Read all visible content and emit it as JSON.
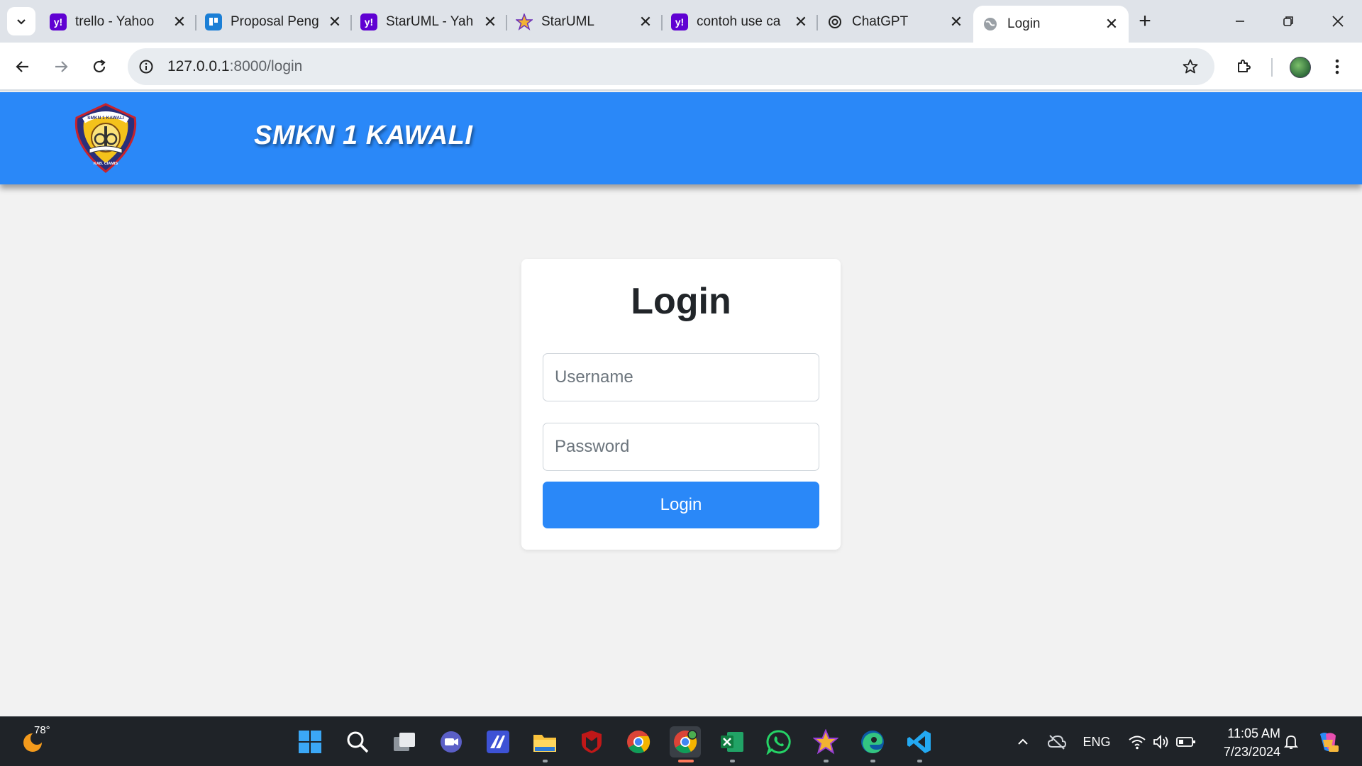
{
  "browser": {
    "tabs": [
      {
        "title": "trello - Yahoo",
        "icon": "yahoo-icon",
        "color": "#6001d2"
      },
      {
        "title": "Proposal Peng",
        "icon": "trello-icon",
        "color": "#1b7fd6"
      },
      {
        "title": "StarUML - Yah",
        "icon": "yahoo-icon",
        "color": "#6001d2"
      },
      {
        "title": "StarUML",
        "icon": "staruml-icon",
        "color": "#e8423a"
      },
      {
        "title": "contoh use ca",
        "icon": "yahoo-icon",
        "color": "#6001d2"
      },
      {
        "title": "ChatGPT",
        "icon": "chatgpt-icon",
        "color": "#222222"
      },
      {
        "title": "Login",
        "icon": "globe-icon",
        "color": "#8a8f96",
        "active": true
      }
    ],
    "url_host": "127.0.0.1",
    "url_path": ":8000/login"
  },
  "header": {
    "site_title": "SMKN 1 KAWALI",
    "logo_top_text": "SMKN 1 KAWALI",
    "logo_bottom_text": "KAB. CIAMIS",
    "color": "#2a88f8"
  },
  "login": {
    "title": "Login",
    "username_placeholder": "Username",
    "password_placeholder": "Password",
    "button_label": "Login"
  },
  "taskbar": {
    "weather_temp": "78°",
    "language": "ENG",
    "time": "11:05 AM",
    "date": "7/23/2024"
  }
}
